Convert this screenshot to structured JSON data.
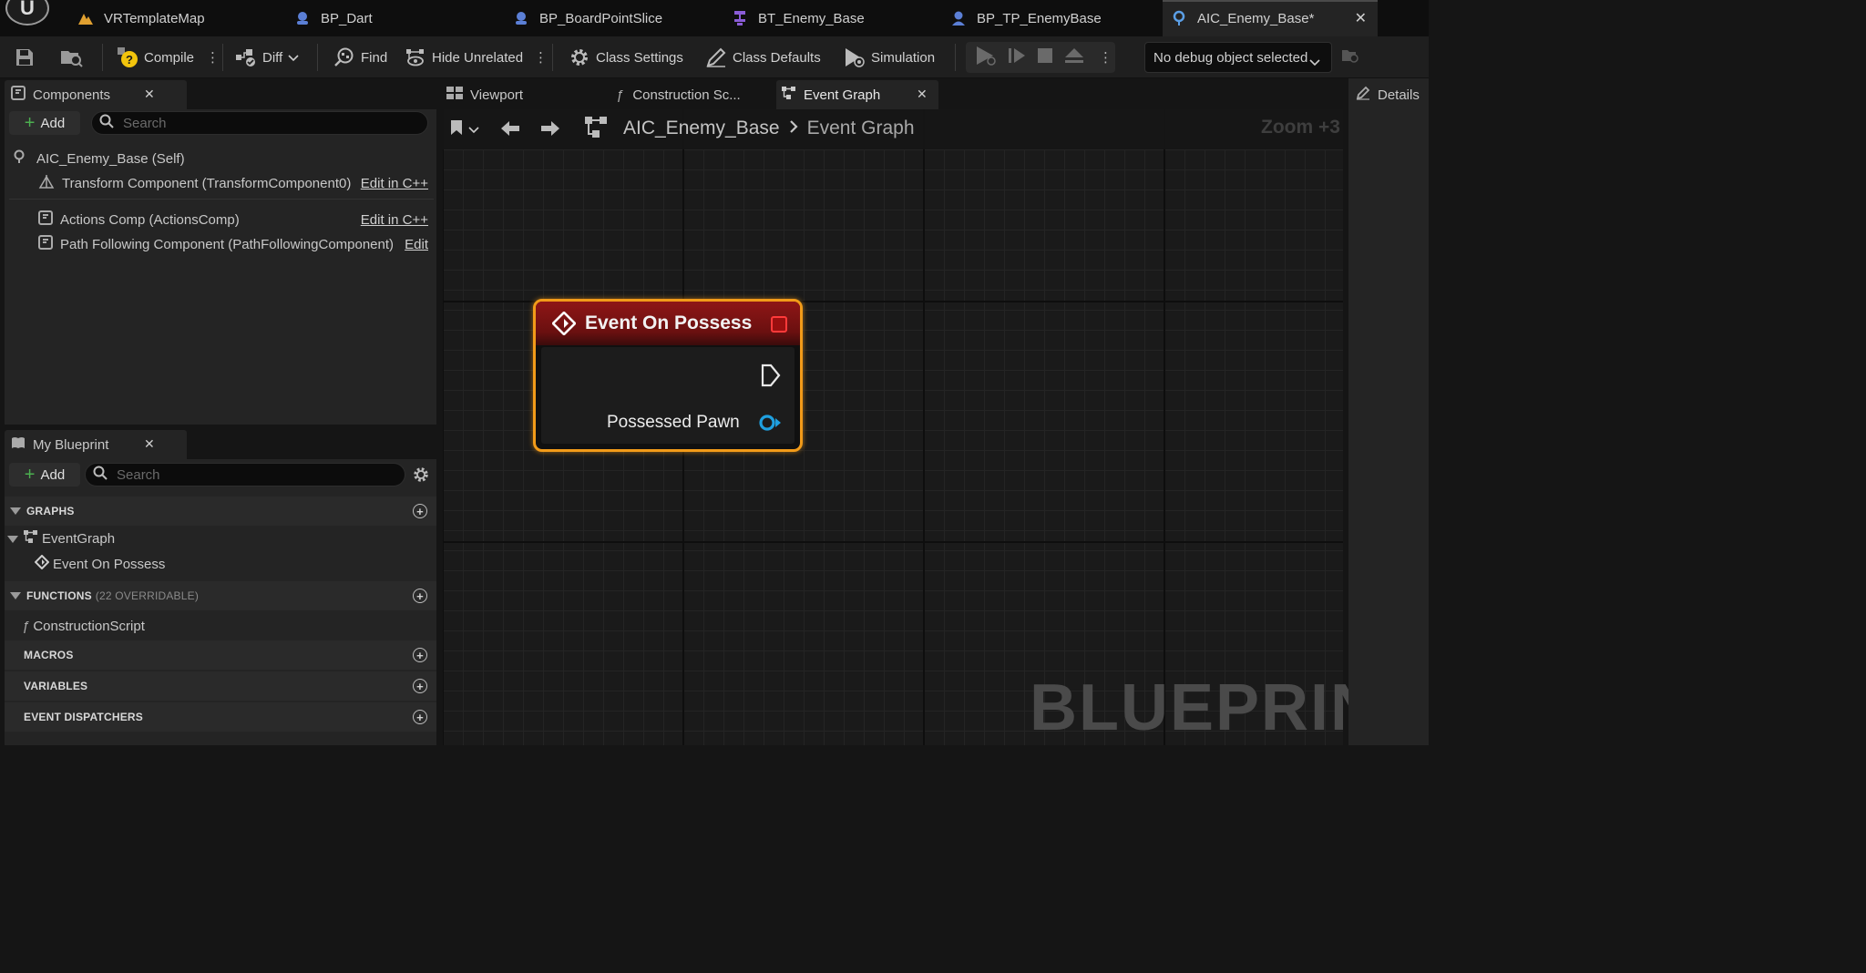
{
  "tabs": [
    {
      "label": "VRTemplateMap",
      "icon": "level-icon",
      "color": "#e0a030"
    },
    {
      "label": "BP_Dart",
      "icon": "blueprint-actor-icon",
      "color": "#5b7fd6"
    },
    {
      "label": "BP_BoardPointSlice",
      "icon": "blueprint-actor-icon",
      "color": "#5b7fd6"
    },
    {
      "label": "BT_Enemy_Base",
      "icon": "behavior-tree-icon",
      "color": "#8a5cd6"
    },
    {
      "label": "BP_TP_EnemyBase",
      "icon": "blueprint-pawn-icon",
      "color": "#5b7fd6"
    },
    {
      "label": "AIC_Enemy_Base*",
      "icon": "ai-controller-icon",
      "color": "#5b9fe6"
    }
  ],
  "toolbar": {
    "compile": "Compile",
    "diff": "Diff",
    "find": "Find",
    "hide_unrelated": "Hide Unrelated",
    "class_settings": "Class Settings",
    "class_defaults": "Class Defaults",
    "simulation": "Simulation",
    "debug_object": "No debug object selected"
  },
  "components": {
    "title": "Components",
    "add_label": "Add",
    "search_placeholder": "Search",
    "items": [
      {
        "label": "AIC_Enemy_Base (Self)",
        "action": ""
      },
      {
        "label": "Transform Component (TransformComponent0)",
        "action": "Edit in C++"
      },
      {
        "label": "Actions Comp (ActionsComp)",
        "action": "Edit in C++"
      },
      {
        "label": "Path Following Component (PathFollowingComponent)",
        "action": "Edit"
      }
    ]
  },
  "my_blueprint": {
    "title": "My Blueprint",
    "add_label": "Add",
    "search_placeholder": "Search",
    "sections": {
      "graphs": "GRAPHS",
      "functions": "FUNCTIONS",
      "functions_note": "(22 OVERRIDABLE)",
      "macros": "MACROS",
      "variables": "VARIABLES",
      "event_dispatchers": "EVENT DISPATCHERS"
    },
    "graph_items": [
      "EventGraph",
      "Event On Possess"
    ],
    "function_items": [
      "ConstructionScript"
    ]
  },
  "editor_tabs": {
    "viewport": "Viewport",
    "construction": "Construction Sc...",
    "event_graph": "Event Graph",
    "details": "Details"
  },
  "graph": {
    "breadcrumb_root": "AIC_Enemy_Base",
    "breadcrumb_current": "Event Graph",
    "zoom": "Zoom +3",
    "watermark": "BLUEPRINT",
    "node_title": "Event On Possess",
    "node_pin": "Possessed Pawn"
  },
  "colors": {
    "node_border": "#f29b19",
    "node_header": "#8f1616",
    "pin_object": "#1fa0e0"
  }
}
